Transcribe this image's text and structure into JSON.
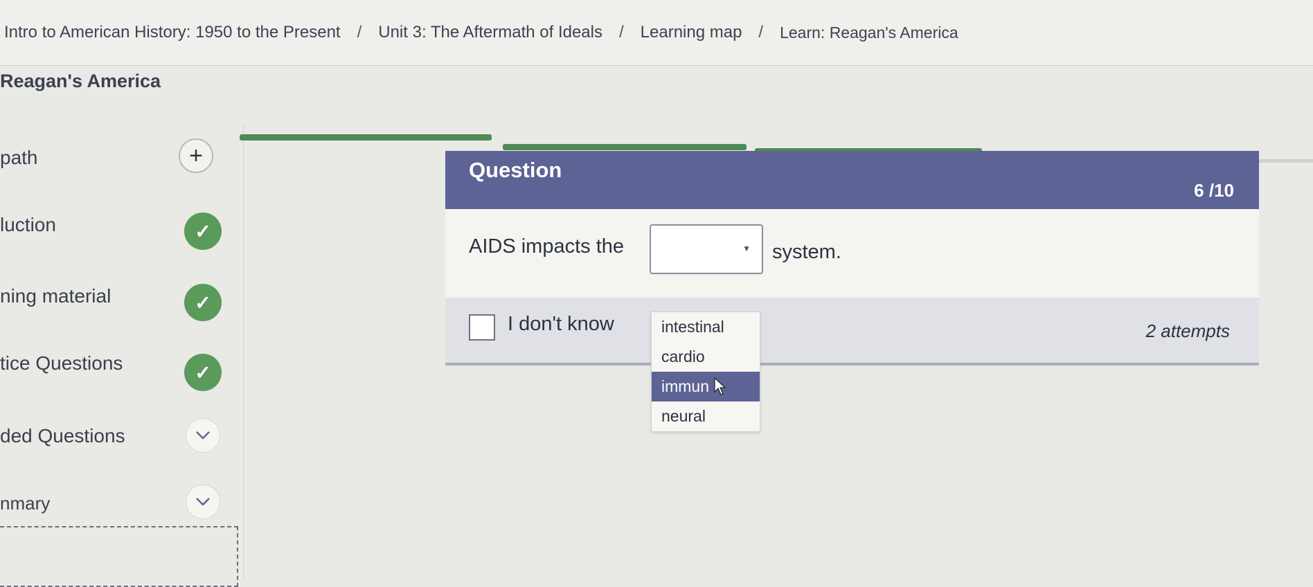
{
  "breadcrumb": {
    "course": "Intro to American History: 1950 to the Present",
    "unit": "Unit 3: The Aftermath of Ideals",
    "map": "Learning map",
    "current": "Learn: Reagan's America",
    "separator": "/"
  },
  "page_title": "Reagan's America",
  "sidebar": {
    "items": [
      {
        "label": "path",
        "icon": "plus-icon"
      },
      {
        "label": "luction",
        "icon": "checkmark-icon"
      },
      {
        "label": "ning material",
        "icon": "checkmark-icon"
      },
      {
        "label": "tice Questions",
        "icon": "checkmark-icon"
      },
      {
        "label": "ded Questions",
        "icon": "chevron-down-icon"
      },
      {
        "label": "nmary",
        "icon": "chevron-down-icon"
      }
    ]
  },
  "question": {
    "title": "Question",
    "counter": "6 /10",
    "prompt_before": "AIDS impacts the",
    "prompt_after": "system.",
    "select_value": "",
    "dont_know_label": "I don't know",
    "attempts": "2 attempts",
    "options": [
      "intestinal",
      "cardio",
      "immun",
      "neural"
    ],
    "highlighted_option": "immun"
  },
  "colors": {
    "header_bg": "#5d6395",
    "check_green": "#5a9a5a",
    "progress_green": "#4e8a55"
  }
}
